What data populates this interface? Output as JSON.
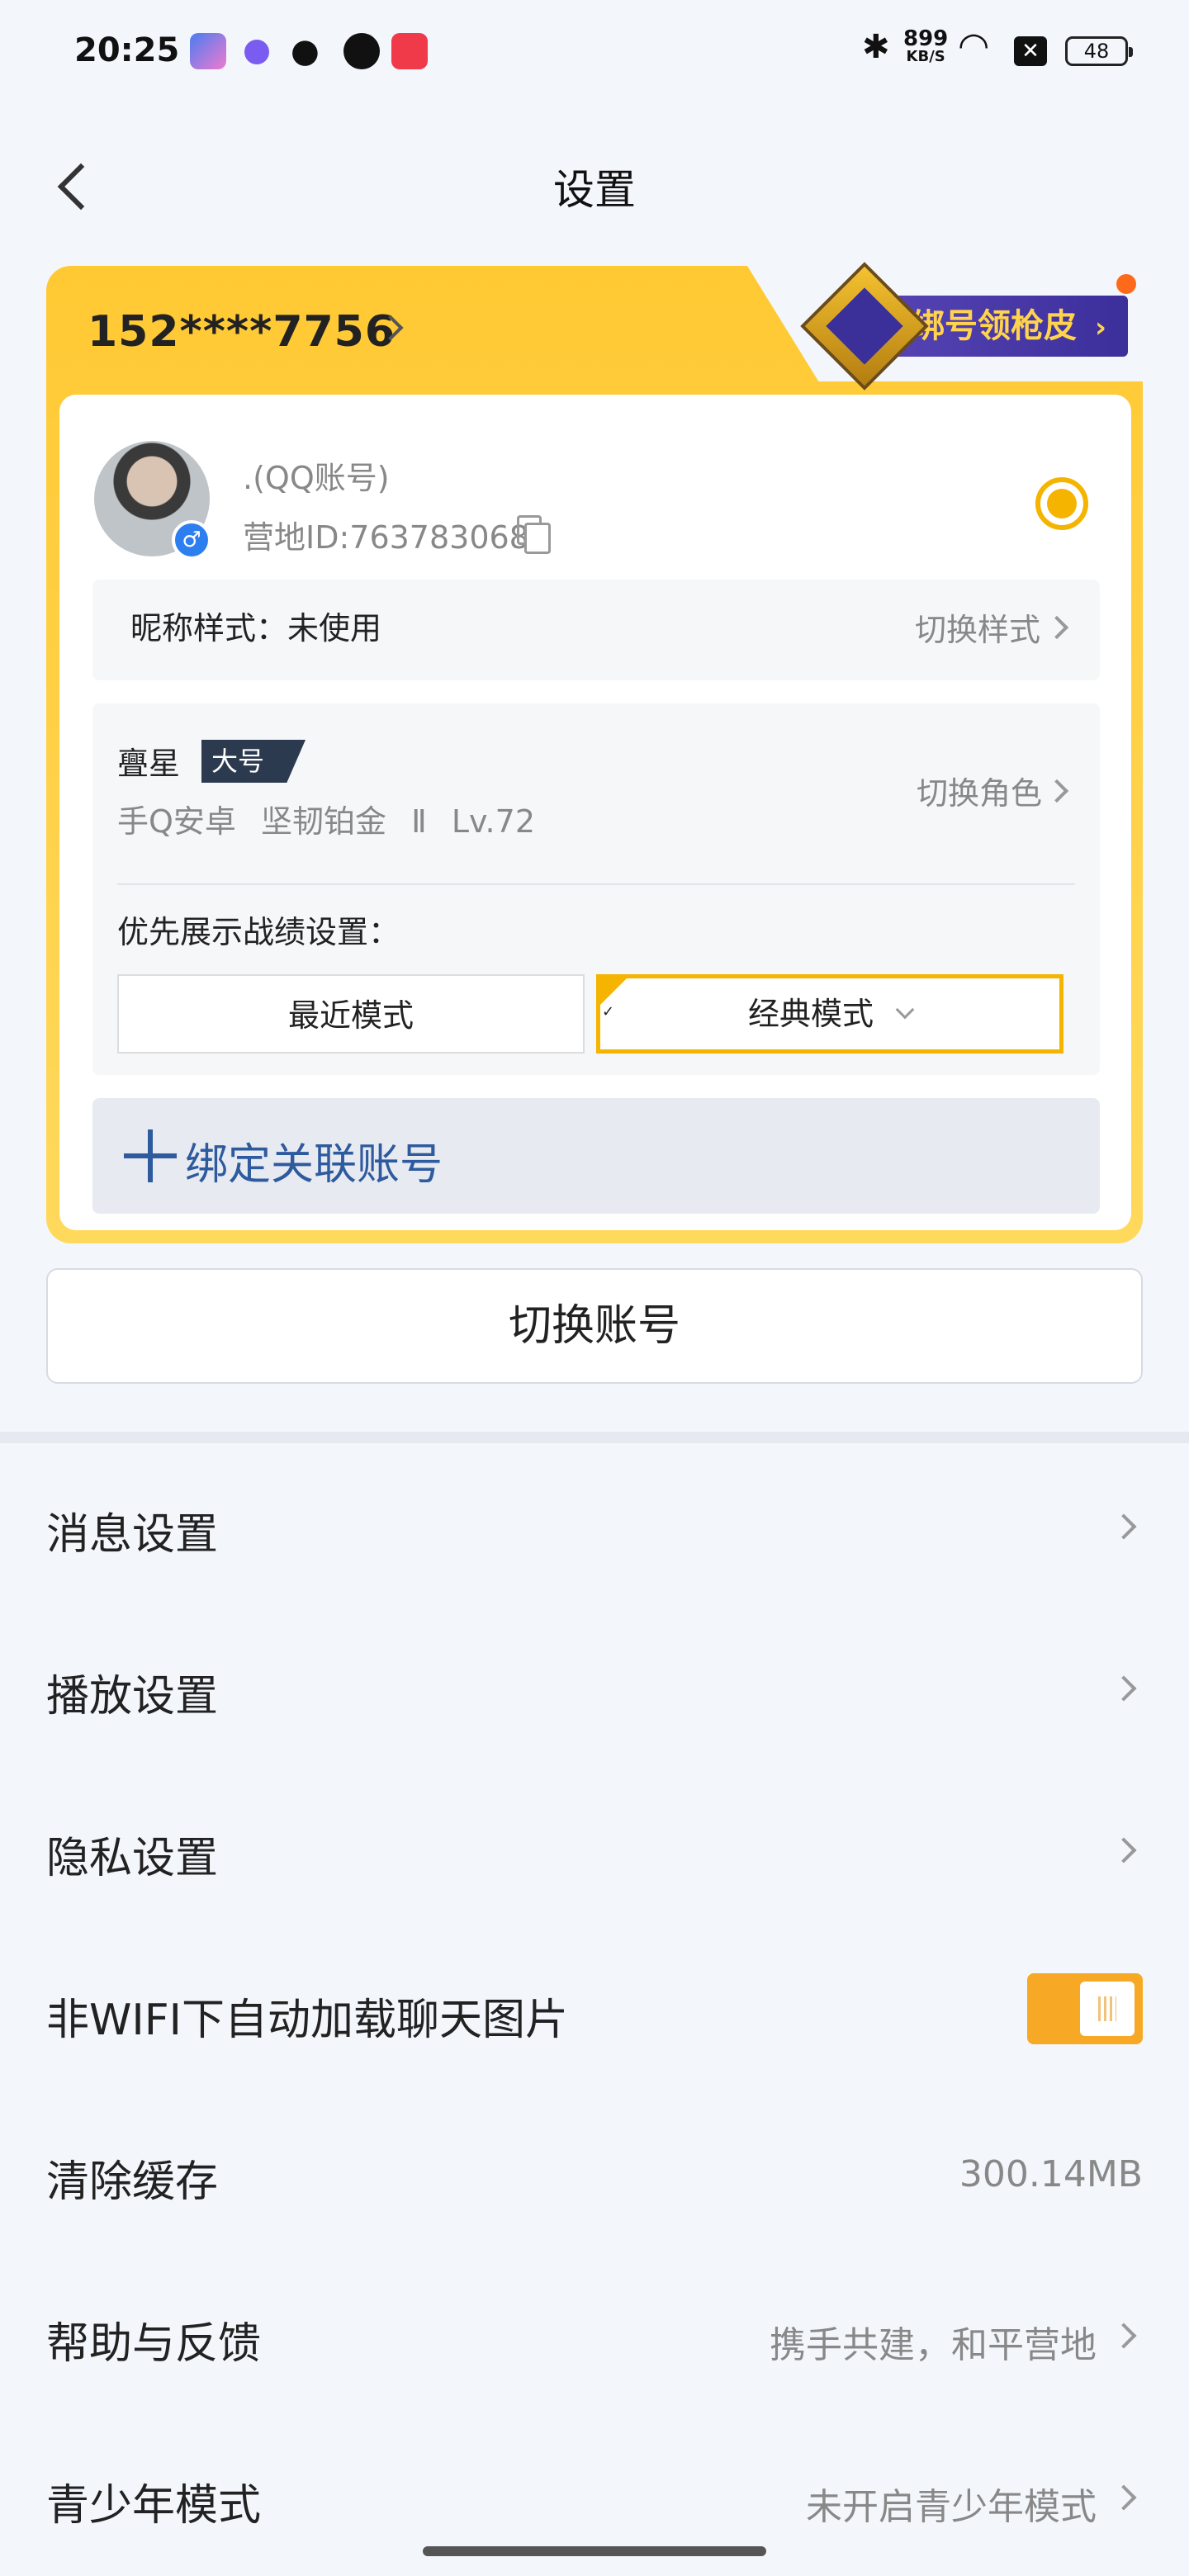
{
  "status_bar": {
    "time": "20:25",
    "net_speed": "899",
    "net_unit": "KB/S",
    "battery": "48"
  },
  "header": {
    "title": "设置"
  },
  "account_card": {
    "phone": "152****7756",
    "skin_banner": "绑号领枪皮",
    "account_name": ".(QQ账号)",
    "camp_id": "营地ID:763783068",
    "gender_symbol": "♂",
    "nickname_style": "昵称样式：未使用",
    "nickname_action": "切换样式",
    "role": {
      "name": "亹星",
      "tag": "大号",
      "detail": "手Q安卓   坚韧铂金 Ⅱ   Lv.72",
      "action": "切换角色"
    },
    "pref_label": "优先展示战绩设置：",
    "modes": {
      "recent": "最近模式",
      "classic": "经典模式",
      "selected": "经典模式"
    },
    "bind_label": "绑定关联账号"
  },
  "switch_account": "切换账号",
  "menu": {
    "message": {
      "label": "消息设置"
    },
    "playback": {
      "label": "播放设置"
    },
    "privacy": {
      "label": "隐私设置"
    },
    "auto_load": {
      "label": "非WIFI下自动加载聊天图片",
      "enabled": true
    },
    "cache": {
      "label": "清除缓存",
      "value": "300.14MB"
    },
    "help": {
      "label": "帮助与反馈",
      "value": "携手共建，和平营地"
    },
    "teen": {
      "label": "青少年模式",
      "value": "未开启青少年模式"
    }
  },
  "colors": {
    "accent": "#f5b400",
    "link": "#2e5a9e",
    "toggle": "#f7a824"
  }
}
